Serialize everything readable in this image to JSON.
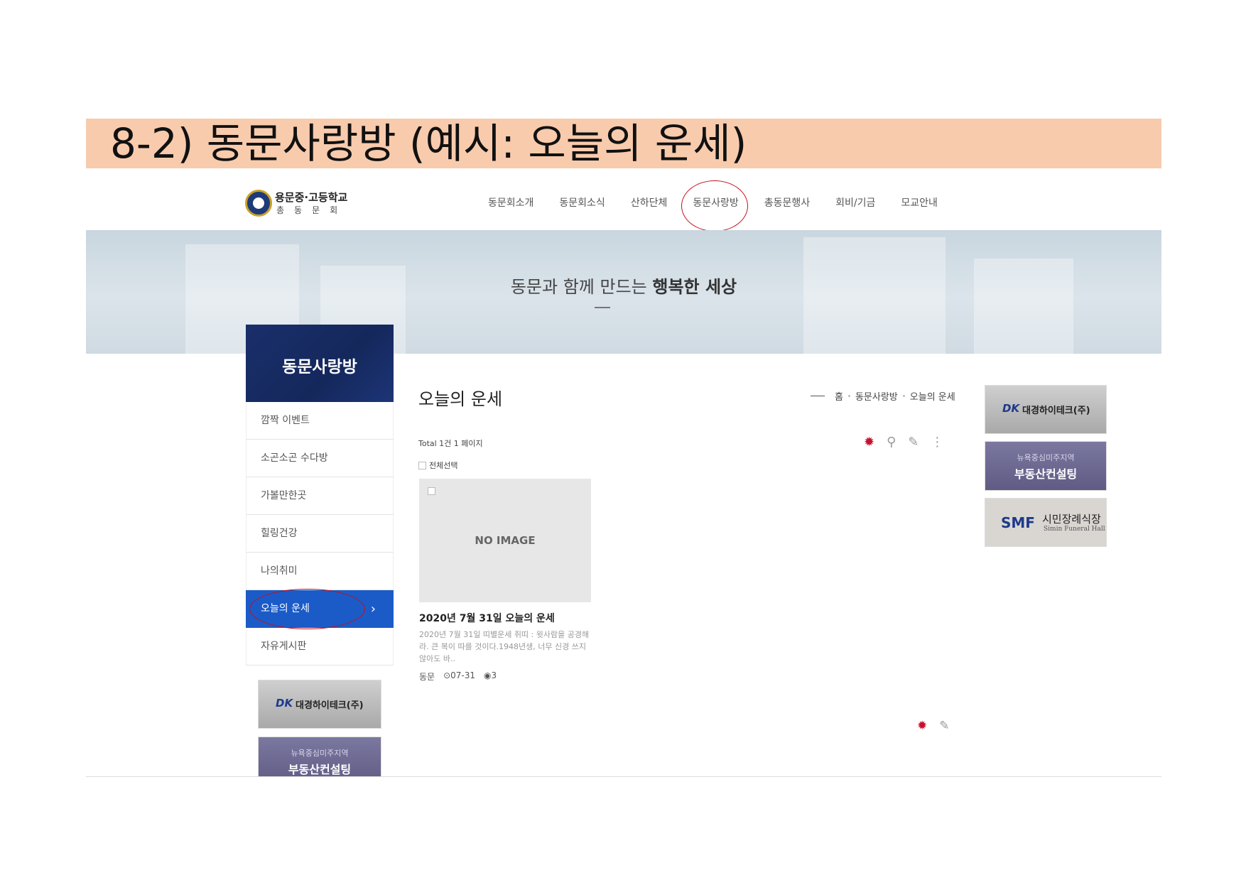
{
  "slide": {
    "title": "8-2) 동문사랑방 (예시: 오늘의 운세)"
  },
  "header": {
    "logo_name": "용문중·고등학교",
    "logo_sub": "총동문회",
    "nav": [
      {
        "label": "동문회소개"
      },
      {
        "label": "동문회소식"
      },
      {
        "label": "산하단체"
      },
      {
        "label": "동문사랑방"
      },
      {
        "label": "총동문행사"
      },
      {
        "label": "회비/기금"
      },
      {
        "label": "모교안내"
      }
    ]
  },
  "hero": {
    "slogan_light": "동문과 함께 만드는 ",
    "slogan_bold": "행복한 세상"
  },
  "sidebar": {
    "title": "동문사랑방",
    "items": [
      {
        "label": "깜짝 이벤트"
      },
      {
        "label": "소곤소곤 수다방"
      },
      {
        "label": "가볼만한곳"
      },
      {
        "label": "힐링건강"
      },
      {
        "label": "나의취미"
      },
      {
        "label": "오늘의 운세",
        "arrow": "›"
      },
      {
        "label": "자유게시판"
      }
    ]
  },
  "banners": {
    "dk_logo": "DK",
    "dk_text": "대경하이테크(주)",
    "re_small": "뉴욕중심미주지역",
    "re_big": "부동산컨설팅",
    "smf_logo": "SMF",
    "smf_name": "시민장례식장",
    "smf_en": "Simin Funeral Hall"
  },
  "content": {
    "title": "오늘의 운세",
    "breadcrumb": [
      "홈",
      "동문사랑방",
      "오늘의 운세"
    ],
    "total": "Total 1건 1 페이지",
    "select_all": "전체선택",
    "card": {
      "no_image": "NO IMAGE",
      "title": "2020년 7월 31일 오늘의 운세",
      "excerpt": "2020년 7월 31일 띠별운세 쥐띠 : 윗사람을 공경해라. 큰 복이 따를 것이다.1948년생, 너무 신경 쓰지 않아도 바..",
      "author": "동문",
      "date": "07-31",
      "views": "3"
    }
  },
  "colors": {
    "accent": "#1b5bc8",
    "navy": "#1a2f6b",
    "annotation": "#c0111f",
    "slide_band": "#f8cbad"
  }
}
